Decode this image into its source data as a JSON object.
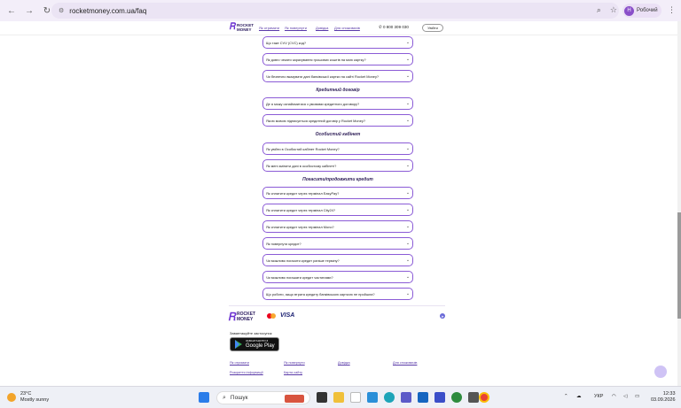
{
  "browser": {
    "url": "rocketmoney.com.ua/faq",
    "profile_initial": "Н",
    "profile_label": "Робочий"
  },
  "header": {
    "logo_text": "ROCKET MONEY",
    "nav": [
      "Як отримати",
      "Як повернути",
      "Довідка",
      "Для споживачів"
    ],
    "phone": "0 800 309 030",
    "login": "Увійти"
  },
  "faq": {
    "group0": [
      "Що таке CVV (CVC) код?",
      "Як довго чекати зарахування грошових коштів на мою картку?",
      "Чи безпечно вказувати дані банківської картки на сайті Rocket Money?"
    ],
    "section1_title": "Кредитний договір",
    "group1": [
      "Де я можу ознайомитися з умовами кредитного договору?",
      "Якою мовою підписується кредитний договір у Rocket Money?"
    ],
    "section2_title": "Особистий кабінет",
    "group2": [
      "Як увійти в Особистий кабінет Rocket Money?",
      "Як мені змінити дані в особистому кабінеті?"
    ],
    "section3_title": "Погасити/продовжити кредит",
    "group3": [
      "Як сплатити кредит через термінал EasyPay?",
      "Як сплатити кредит через термінал City24?",
      "Як сплатити кредит через термінал Monо?",
      "Як повернути кредит?",
      "Чи можливо погасити кредит раніше терміну?",
      "Чи можливо погашати кредит частинами?",
      "Що робити, якщо втрата кредиту банківською карткою не пройшла?"
    ]
  },
  "footer": {
    "logo_text": "ROCKET MONEY",
    "visa": "VISA",
    "download_label": "Завантажуйте застосунок",
    "gplay_line1": "ЗАВАНТАЖИТИ З",
    "gplay_line2": "Google Play",
    "links": [
      "Як отримати",
      "Як повернути",
      "Довідка",
      "Для споживачів",
      "Розкриття інформації",
      "Карта сайту"
    ]
  },
  "taskbar": {
    "temp": "23°C",
    "weather": "Mostly sunny",
    "search": "Пошук",
    "lang": "УКР",
    "time": "12:33",
    "date": "03.09.2026"
  },
  "colors": {
    "accent": "#8b5bd6",
    "heading": "#2b1b55"
  }
}
